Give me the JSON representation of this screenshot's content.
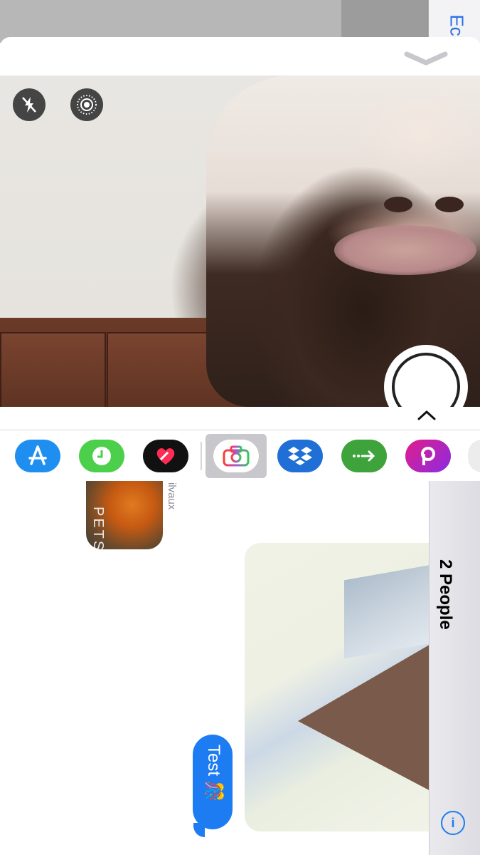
{
  "background": {
    "edit_label": "Ec"
  },
  "sheet": {
    "grabber_icon": "chevron-down-icon",
    "camera": {
      "flash_icon": "flash-off-icon",
      "live_icon": "live-photo-icon",
      "shutter_icon": "shutter-icon",
      "expand_icon": "chevron-up-icon"
    }
  },
  "app_strip": {
    "apps": [
      {
        "name": "App Store",
        "icon": "app-store-icon",
        "color": "#1f8ef1"
      },
      {
        "name": "Clock",
        "icon": "clock-icon",
        "color": "#4ccf4a"
      },
      {
        "name": "Digital Touch",
        "icon": "heart-touch-icon",
        "color": "#111111"
      },
      {
        "name": "Camera Effects",
        "icon": "camera-icon",
        "color": "#c8c8cc"
      },
      {
        "name": "Dropbox",
        "icon": "dropbox-icon",
        "color": "#1f6fd6"
      },
      {
        "name": "Send",
        "icon": "arrow-icon",
        "color": "#3ea33a"
      },
      {
        "name": "PicsArt",
        "icon": "picsart-icon",
        "color": "#c02fb4"
      }
    ]
  },
  "conversation": {
    "sticker_text": "PETS",
    "sender_fragment": "ilvaux",
    "message_text": "Test 🎊",
    "people_label": "2 People",
    "info_icon": "info-icon"
  }
}
